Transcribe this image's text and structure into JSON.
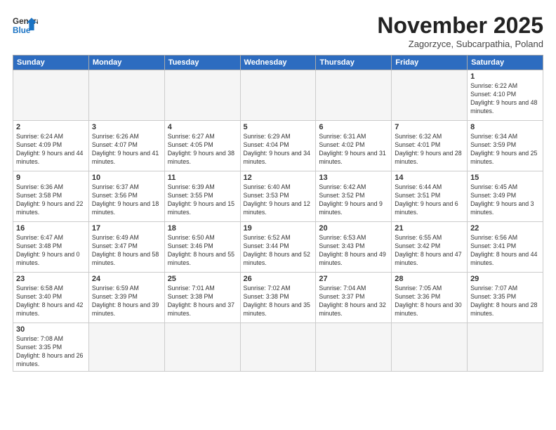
{
  "header": {
    "logo_general": "General",
    "logo_blue": "Blue",
    "month_title": "November 2025",
    "subtitle": "Zagorzyce, Subcarpathia, Poland"
  },
  "weekdays": [
    "Sunday",
    "Monday",
    "Tuesday",
    "Wednesday",
    "Thursday",
    "Friday",
    "Saturday"
  ],
  "weeks": [
    [
      {
        "date": "",
        "info": ""
      },
      {
        "date": "",
        "info": ""
      },
      {
        "date": "",
        "info": ""
      },
      {
        "date": "",
        "info": ""
      },
      {
        "date": "",
        "info": ""
      },
      {
        "date": "",
        "info": ""
      },
      {
        "date": "1",
        "info": "Sunrise: 6:22 AM\nSunset: 4:10 PM\nDaylight: 9 hours and 48 minutes."
      }
    ],
    [
      {
        "date": "2",
        "info": "Sunrise: 6:24 AM\nSunset: 4:09 PM\nDaylight: 9 hours and 44 minutes."
      },
      {
        "date": "3",
        "info": "Sunrise: 6:26 AM\nSunset: 4:07 PM\nDaylight: 9 hours and 41 minutes."
      },
      {
        "date": "4",
        "info": "Sunrise: 6:27 AM\nSunset: 4:05 PM\nDaylight: 9 hours and 38 minutes."
      },
      {
        "date": "5",
        "info": "Sunrise: 6:29 AM\nSunset: 4:04 PM\nDaylight: 9 hours and 34 minutes."
      },
      {
        "date": "6",
        "info": "Sunrise: 6:31 AM\nSunset: 4:02 PM\nDaylight: 9 hours and 31 minutes."
      },
      {
        "date": "7",
        "info": "Sunrise: 6:32 AM\nSunset: 4:01 PM\nDaylight: 9 hours and 28 minutes."
      },
      {
        "date": "8",
        "info": "Sunrise: 6:34 AM\nSunset: 3:59 PM\nDaylight: 9 hours and 25 minutes."
      }
    ],
    [
      {
        "date": "9",
        "info": "Sunrise: 6:36 AM\nSunset: 3:58 PM\nDaylight: 9 hours and 22 minutes."
      },
      {
        "date": "10",
        "info": "Sunrise: 6:37 AM\nSunset: 3:56 PM\nDaylight: 9 hours and 18 minutes."
      },
      {
        "date": "11",
        "info": "Sunrise: 6:39 AM\nSunset: 3:55 PM\nDaylight: 9 hours and 15 minutes."
      },
      {
        "date": "12",
        "info": "Sunrise: 6:40 AM\nSunset: 3:53 PM\nDaylight: 9 hours and 12 minutes."
      },
      {
        "date": "13",
        "info": "Sunrise: 6:42 AM\nSunset: 3:52 PM\nDaylight: 9 hours and 9 minutes."
      },
      {
        "date": "14",
        "info": "Sunrise: 6:44 AM\nSunset: 3:51 PM\nDaylight: 9 hours and 6 minutes."
      },
      {
        "date": "15",
        "info": "Sunrise: 6:45 AM\nSunset: 3:49 PM\nDaylight: 9 hours and 3 minutes."
      }
    ],
    [
      {
        "date": "16",
        "info": "Sunrise: 6:47 AM\nSunset: 3:48 PM\nDaylight: 9 hours and 0 minutes."
      },
      {
        "date": "17",
        "info": "Sunrise: 6:49 AM\nSunset: 3:47 PM\nDaylight: 8 hours and 58 minutes."
      },
      {
        "date": "18",
        "info": "Sunrise: 6:50 AM\nSunset: 3:46 PM\nDaylight: 8 hours and 55 minutes."
      },
      {
        "date": "19",
        "info": "Sunrise: 6:52 AM\nSunset: 3:44 PM\nDaylight: 8 hours and 52 minutes."
      },
      {
        "date": "20",
        "info": "Sunrise: 6:53 AM\nSunset: 3:43 PM\nDaylight: 8 hours and 49 minutes."
      },
      {
        "date": "21",
        "info": "Sunrise: 6:55 AM\nSunset: 3:42 PM\nDaylight: 8 hours and 47 minutes."
      },
      {
        "date": "22",
        "info": "Sunrise: 6:56 AM\nSunset: 3:41 PM\nDaylight: 8 hours and 44 minutes."
      }
    ],
    [
      {
        "date": "23",
        "info": "Sunrise: 6:58 AM\nSunset: 3:40 PM\nDaylight: 8 hours and 42 minutes."
      },
      {
        "date": "24",
        "info": "Sunrise: 6:59 AM\nSunset: 3:39 PM\nDaylight: 8 hours and 39 minutes."
      },
      {
        "date": "25",
        "info": "Sunrise: 7:01 AM\nSunset: 3:38 PM\nDaylight: 8 hours and 37 minutes."
      },
      {
        "date": "26",
        "info": "Sunrise: 7:02 AM\nSunset: 3:38 PM\nDaylight: 8 hours and 35 minutes."
      },
      {
        "date": "27",
        "info": "Sunrise: 7:04 AM\nSunset: 3:37 PM\nDaylight: 8 hours and 32 minutes."
      },
      {
        "date": "28",
        "info": "Sunrise: 7:05 AM\nSunset: 3:36 PM\nDaylight: 8 hours and 30 minutes."
      },
      {
        "date": "29",
        "info": "Sunrise: 7:07 AM\nSunset: 3:35 PM\nDaylight: 8 hours and 28 minutes."
      }
    ],
    [
      {
        "date": "30",
        "info": "Sunrise: 7:08 AM\nSunset: 3:35 PM\nDaylight: 8 hours and 26 minutes."
      },
      {
        "date": "",
        "info": ""
      },
      {
        "date": "",
        "info": ""
      },
      {
        "date": "",
        "info": ""
      },
      {
        "date": "",
        "info": ""
      },
      {
        "date": "",
        "info": ""
      },
      {
        "date": "",
        "info": ""
      }
    ]
  ]
}
